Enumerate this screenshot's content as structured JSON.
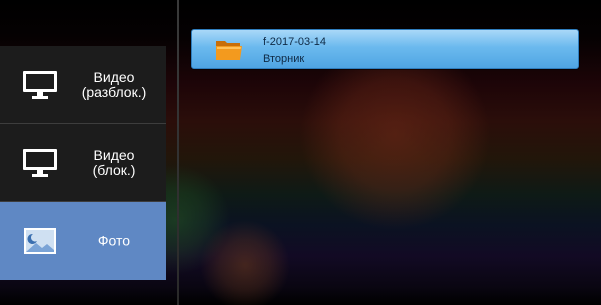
{
  "sidebar": {
    "items": [
      {
        "label": "Видео\n(разблок.)",
        "icon": "monitor-icon",
        "active": false
      },
      {
        "label": "Видео\n(блок.)",
        "icon": "monitor-icon",
        "active": false
      },
      {
        "label": "Фото",
        "icon": "photo-icon",
        "active": true
      }
    ]
  },
  "files": [
    {
      "name": "f-2017-03-14",
      "subtitle": "Вторник",
      "icon": "folder-icon"
    }
  ],
  "colors": {
    "active_item": "#5f88c4",
    "sidebar_bg": "#1c1c1c",
    "file_highlight": "#6bb9ee",
    "folder": "#f39a1e"
  }
}
